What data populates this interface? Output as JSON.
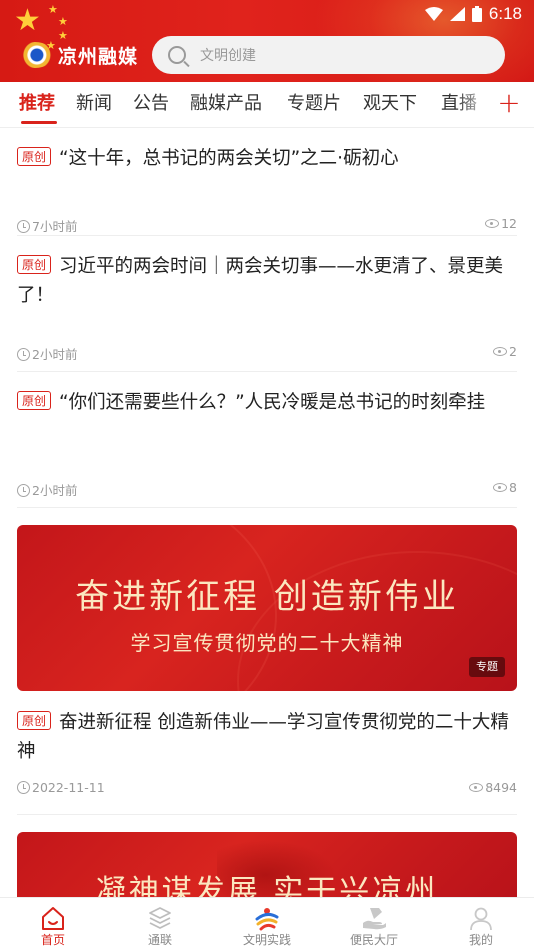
{
  "status_bar": {
    "time": "6:18"
  },
  "header": {
    "app_name": "凉州融媒",
    "search_placeholder": "文明创建"
  },
  "tabs": [
    {
      "label": "推荐",
      "active": true
    },
    {
      "label": "新闻",
      "active": false
    },
    {
      "label": "公告",
      "active": false
    },
    {
      "label": "融媒产品",
      "active": false
    },
    {
      "label": "专题片",
      "active": false
    },
    {
      "label": "观天下",
      "active": false
    },
    {
      "label": "直播",
      "active": false
    }
  ],
  "tab_add": "+",
  "feed": [
    {
      "badge": "原创",
      "title": "“这十年，总书记的两会关切”之二·砺初心",
      "time": "7小时前",
      "views": "12"
    },
    {
      "badge": "原创",
      "title": "习近平的两会时间｜两会关切事——水更清了、景更美了！",
      "time": "2小时前",
      "views": "2"
    },
    {
      "badge": "原创",
      "title": "“你们还需要些什么？”人民冷暖是总书记的时刻牵挂",
      "time": "2小时前",
      "views": "8"
    },
    {
      "banner_main": "奋进新征程  创造新伟业",
      "banner_sub": "学习宣传贯彻党的二十大精神",
      "banner_tag": "专题",
      "badge": "原创",
      "title": "奋进新征程 创造新伟业——学习宣传贯彻党的二十大精神",
      "time": "2022-11-11",
      "views": "8494"
    },
    {
      "banner_main": "凝神谋发展  实干兴凉州"
    }
  ],
  "bottom_nav": [
    {
      "label": "首页",
      "icon": "home-icon",
      "active": true
    },
    {
      "label": "通联",
      "icon": "layers-icon",
      "active": false
    },
    {
      "label": "文明实践",
      "icon": "civilization-logo-icon",
      "active": false
    },
    {
      "label": "便民大厅",
      "icon": "service-hand-icon",
      "active": false
    },
    {
      "label": "我的",
      "icon": "user-icon",
      "active": false
    }
  ],
  "colors": {
    "brand_red": "#d9231b",
    "header_red": "#e0231c",
    "banner_text": "#fbe7c0",
    "muted": "#999999"
  }
}
